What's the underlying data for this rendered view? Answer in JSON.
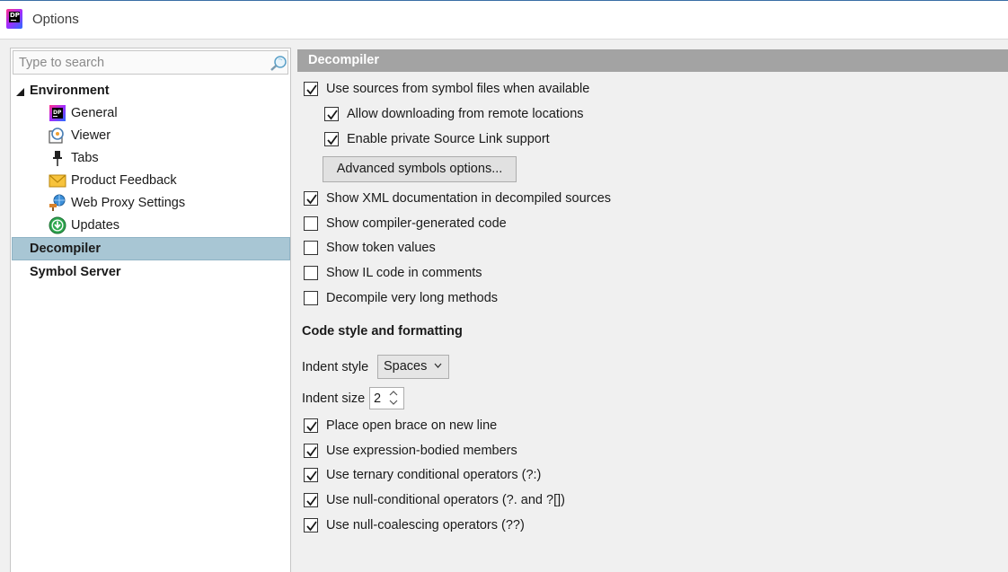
{
  "window": {
    "title": "Options",
    "app_icon_text": "DP"
  },
  "search": {
    "placeholder": "Type to search",
    "value": ""
  },
  "tree": {
    "environment": "Environment",
    "children": [
      "General",
      "Viewer",
      "Tabs",
      "Product Feedback",
      "Web Proxy Settings",
      "Updates"
    ],
    "decompiler": "Decompiler",
    "symbol_server": "Symbol Server",
    "selected": "Decompiler"
  },
  "section": {
    "title": "Decompiler"
  },
  "options": [
    {
      "label": "Use sources from symbol files when available",
      "checked": true
    },
    {
      "label": "Allow downloading from remote locations",
      "checked": true
    },
    {
      "label": "Enable private Source Link support",
      "checked": true
    },
    {
      "label": "Show XML documentation in decompiled sources",
      "checked": true
    },
    {
      "label": "Show compiler-generated code",
      "checked": false
    },
    {
      "label": "Show token values",
      "checked": false
    },
    {
      "label": "Show IL code in comments",
      "checked": false
    },
    {
      "label": "Decompile very long methods",
      "checked": false
    }
  ],
  "advanced_button": "Advanced symbols options...",
  "code_style": {
    "title": "Code style and formatting",
    "indent_style_label": "Indent style",
    "indent_style_value": "Spaces",
    "indent_size_label": "Indent size",
    "indent_size_value": "2",
    "options": [
      {
        "label": "Place open brace on new line",
        "checked": true
      },
      {
        "label": "Use expression-bodied members",
        "checked": true
      },
      {
        "label": "Use ternary conditional operators (?:)",
        "checked": true
      },
      {
        "label": "Use null-conditional operators (?. and ?[])",
        "checked": true
      },
      {
        "label": "Use null-coalescing operators (??)",
        "checked": true
      }
    ]
  },
  "colors": {
    "selection": "#a8c6d4",
    "header": "#a3a3a3",
    "titlebar_accent": "#3a6ea5"
  }
}
